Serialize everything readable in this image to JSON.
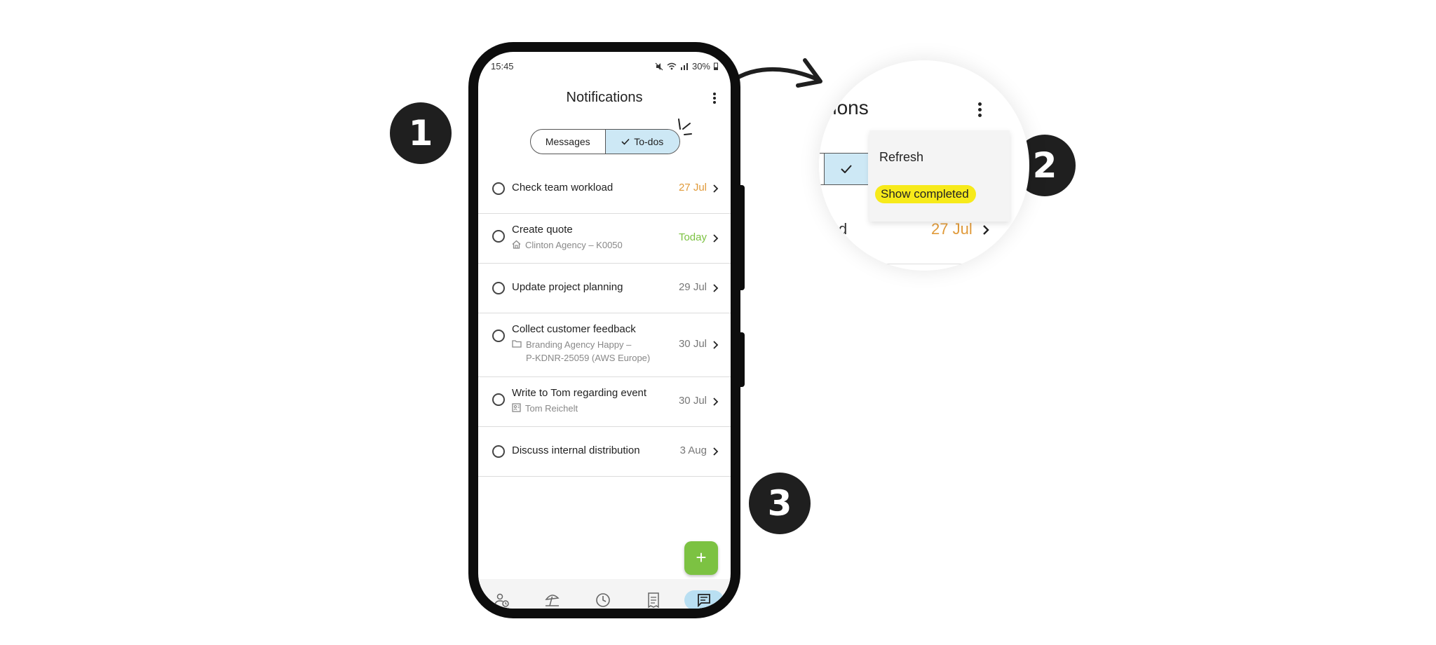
{
  "badges": [
    "1",
    "2",
    "3"
  ],
  "status": {
    "time": "15:45",
    "battery": "30%"
  },
  "appbar": {
    "title": "Notifications"
  },
  "tabs": [
    {
      "label": "Messages",
      "active": false
    },
    {
      "label": "To-dos",
      "active": true
    }
  ],
  "todos": [
    {
      "title": "Check team workload",
      "date": "27 Jul",
      "date_color": "#e09a3a",
      "sub_icon": "",
      "sub1": "",
      "sub2": ""
    },
    {
      "title": "Create quote",
      "date": "Today",
      "date_color": "#7cc242",
      "sub_icon": "home-icon",
      "sub1": "Clinton Agency – K0050",
      "sub2": ""
    },
    {
      "title": "Update project planning",
      "date": "29 Jul",
      "date_color": "#777777",
      "sub_icon": "",
      "sub1": "",
      "sub2": ""
    },
    {
      "title": "Collect customer feedback",
      "date": "30 Jul",
      "date_color": "#777777",
      "sub_icon": "folder-icon",
      "sub1": "Branding Agency Happy –",
      "sub2": "P-KDNR-25059 (AWS Europe)"
    },
    {
      "title": "Write to Tom regarding event",
      "date": "30 Jul",
      "date_color": "#777777",
      "sub_icon": "contact-card-icon",
      "sub1": "Tom Reichelt",
      "sub2": ""
    },
    {
      "title": "Discuss internal distribution",
      "date": "3 Aug",
      "date_color": "#777777",
      "sub_icon": "",
      "sub1": "",
      "sub2": ""
    }
  ],
  "fab": {
    "label": "+"
  },
  "bottom_nav": [
    {
      "icon": "person-clock-icon",
      "active": false
    },
    {
      "icon": "beach-umbrella-icon",
      "active": false
    },
    {
      "icon": "clock-icon",
      "active": false
    },
    {
      "icon": "receipt-icon",
      "active": false
    },
    {
      "icon": "chat-icon",
      "active": true
    }
  ],
  "zoom": {
    "title_fragment": "ations",
    "menu": {
      "refresh": "Refresh",
      "show_completed": "Show completed"
    },
    "row_fragment": "d",
    "row_date": "27 Jul"
  },
  "colors": {
    "accent_green": "#7cc242",
    "highlight_yellow": "#f7ea1a",
    "tab_active": "#cde8f5",
    "date_orange": "#e09a3a"
  }
}
